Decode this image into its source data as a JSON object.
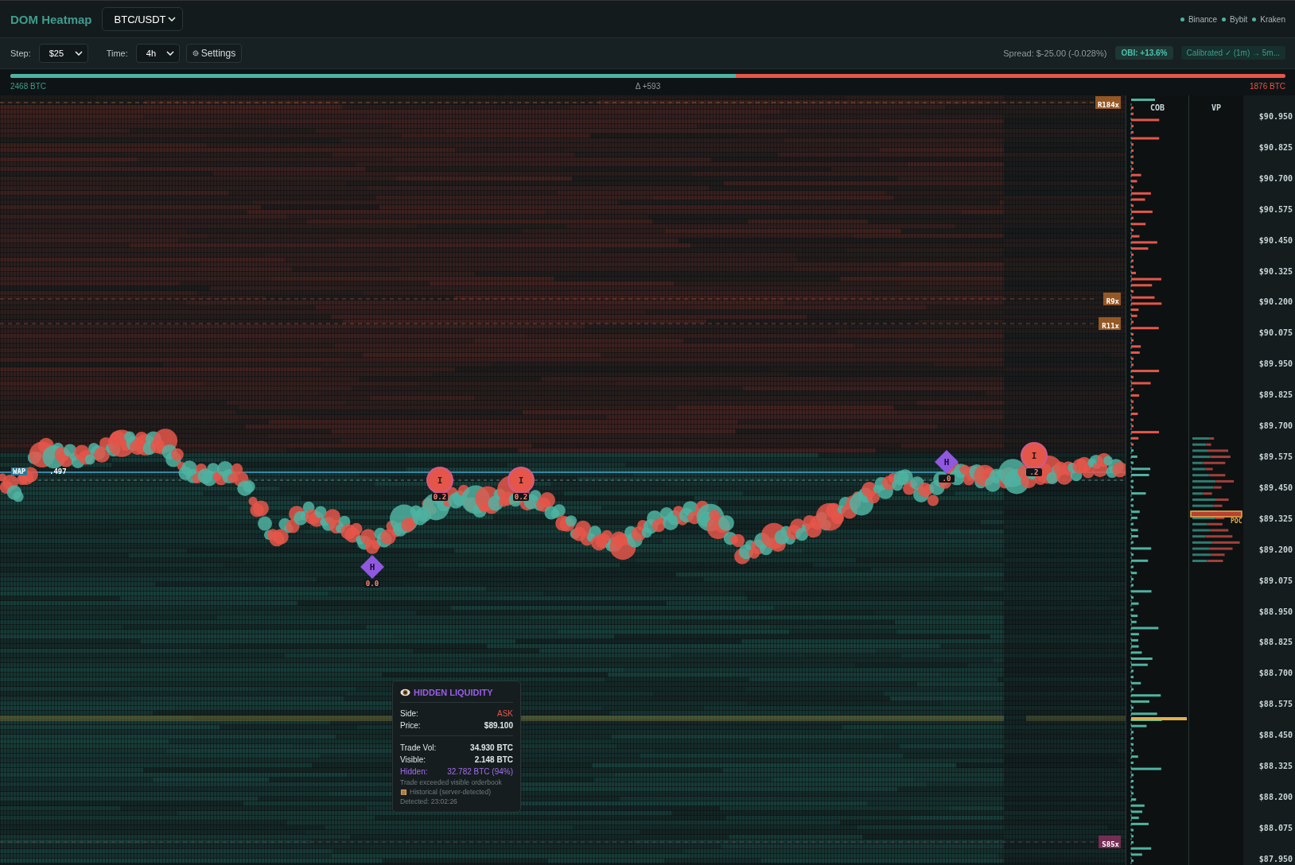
{
  "header": {
    "title": "DOM Heatmap",
    "symbol": "BTC/USDT",
    "exchanges": [
      {
        "name": "Binance",
        "color": "#4fb3a1"
      },
      {
        "name": "Bybit",
        "color": "#4fb3a1"
      },
      {
        "name": "Kraken",
        "color": "#4fb3a1"
      }
    ]
  },
  "toolbar": {
    "step_label": "Step:",
    "step": "$25",
    "time_label": "Time:",
    "time": "4h",
    "settings": "Settings",
    "spread": "Spread: $-25.00 (-0.028%)",
    "obi": "OBI: +13.6%",
    "calibration": "Calibrated ✓ (1m) → 5m..."
  },
  "balance": {
    "bid_total": "2468 BTC",
    "delta": "Δ +593",
    "ask_total": "1876 BTC",
    "level": 0.569
  },
  "heatmap": {
    "levels": [
      {
        "kind": "resistance",
        "label": "R184x"
      },
      {
        "kind": "resistance",
        "label": "R9x"
      },
      {
        "kind": "resistance",
        "label": "R11x"
      },
      {
        "kind": "support",
        "label": "S85x"
      }
    ],
    "wap": {
      "label": "WAP",
      "value": ".497"
    },
    "markers": [
      {
        "kind": "hidden",
        "label": "H",
        "value": "0.0"
      },
      {
        "kind": "iceberg",
        "label": "I",
        "value": "0.2"
      },
      {
        "kind": "iceberg",
        "label": "I",
        "value": "0.2"
      },
      {
        "kind": "hidden",
        "label": "H",
        "value": ".0"
      },
      {
        "kind": "iceberg",
        "label": "I",
        "value": ".2"
      }
    ]
  },
  "tooltip": {
    "title": "HIDDEN LIQUIDITY",
    "rows": [
      {
        "kind": "side",
        "label": "Side:",
        "value": "ASK"
      },
      {
        "kind": "plain",
        "label": "Price:",
        "value": "$89.100"
      },
      {
        "kind": "divider",
        "label": "Trade Vol:",
        "value": "34.930 BTC"
      },
      {
        "kind": "plain",
        "label": "Visible:",
        "value": "2.148 BTC"
      },
      {
        "kind": "hidden",
        "label": "Hidden:",
        "value": "32.782 BTC (94%)"
      }
    ],
    "note": "Trade exceeded visible orderbook",
    "source": "Historical (server-detected)",
    "detected": "Detected: 23:02:26"
  },
  "cob": {
    "title": "COB"
  },
  "vp": {
    "title": "VP",
    "poc": "POC"
  },
  "price_axis": [
    "$90.950",
    "$90.825",
    "$90.700",
    "$90.575",
    "$90.450",
    "$90.325",
    "$90.200",
    "$90.075",
    "$89.950",
    "$89.825",
    "$89.700",
    "$89.575",
    "$89.450",
    "$89.325",
    "$89.200",
    "$89.075",
    "$88.950",
    "$88.825",
    "$88.700",
    "$88.575",
    "$88.450",
    "$88.325",
    "$88.200",
    "$88.075",
    "$87.950"
  ]
}
